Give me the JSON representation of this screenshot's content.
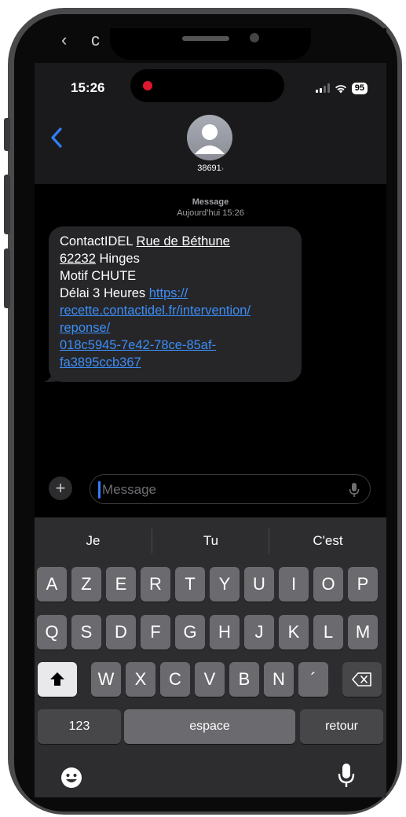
{
  "status_bar": {
    "time": "15:26",
    "battery": "95"
  },
  "header": {
    "contact_name": "38691",
    "contact_chevron": "›",
    "back_icon": "chevron-left-icon",
    "accent_color": "#2f7ff6"
  },
  "thread": {
    "meta_label": "Message",
    "meta_time": "Aujourd’hui 15:26",
    "bubble": {
      "line1_prefix": "ContactIDEL ",
      "line1_link": "Rue de Béthune",
      "line2_link": "62232",
      "line2_suffix": " Hinges",
      "line3": "Motif CHUTE",
      "line4_prefix": "Délai 3  Heures  ",
      "url": "https:// recette.contactidel.fr/intervention/ reponse/ 018c5945-7e42-78ce-85af- fa3895ccb367",
      "url_parts": [
        "https://",
        "recette.contactidel.fr/intervention/",
        "reponse/",
        "018c5945-7e42-78ce-85af-",
        "fa3895ccb367"
      ],
      "link_color": "#3d8ef7"
    }
  },
  "compose": {
    "plus_label": "+",
    "placeholder": "Message"
  },
  "keyboard": {
    "suggestions": [
      "Je",
      "Tu",
      "C'est"
    ],
    "row1": [
      "A",
      "Z",
      "E",
      "R",
      "T",
      "Y",
      "U",
      "I",
      "O",
      "P"
    ],
    "row2": [
      "Q",
      "S",
      "D",
      "F",
      "G",
      "H",
      "J",
      "K",
      "L",
      "M"
    ],
    "row3": [
      "W",
      "X",
      "C",
      "V",
      "B",
      "N",
      "´"
    ],
    "numbers_key": "123",
    "space_key": "espace",
    "return_key": "retour"
  }
}
